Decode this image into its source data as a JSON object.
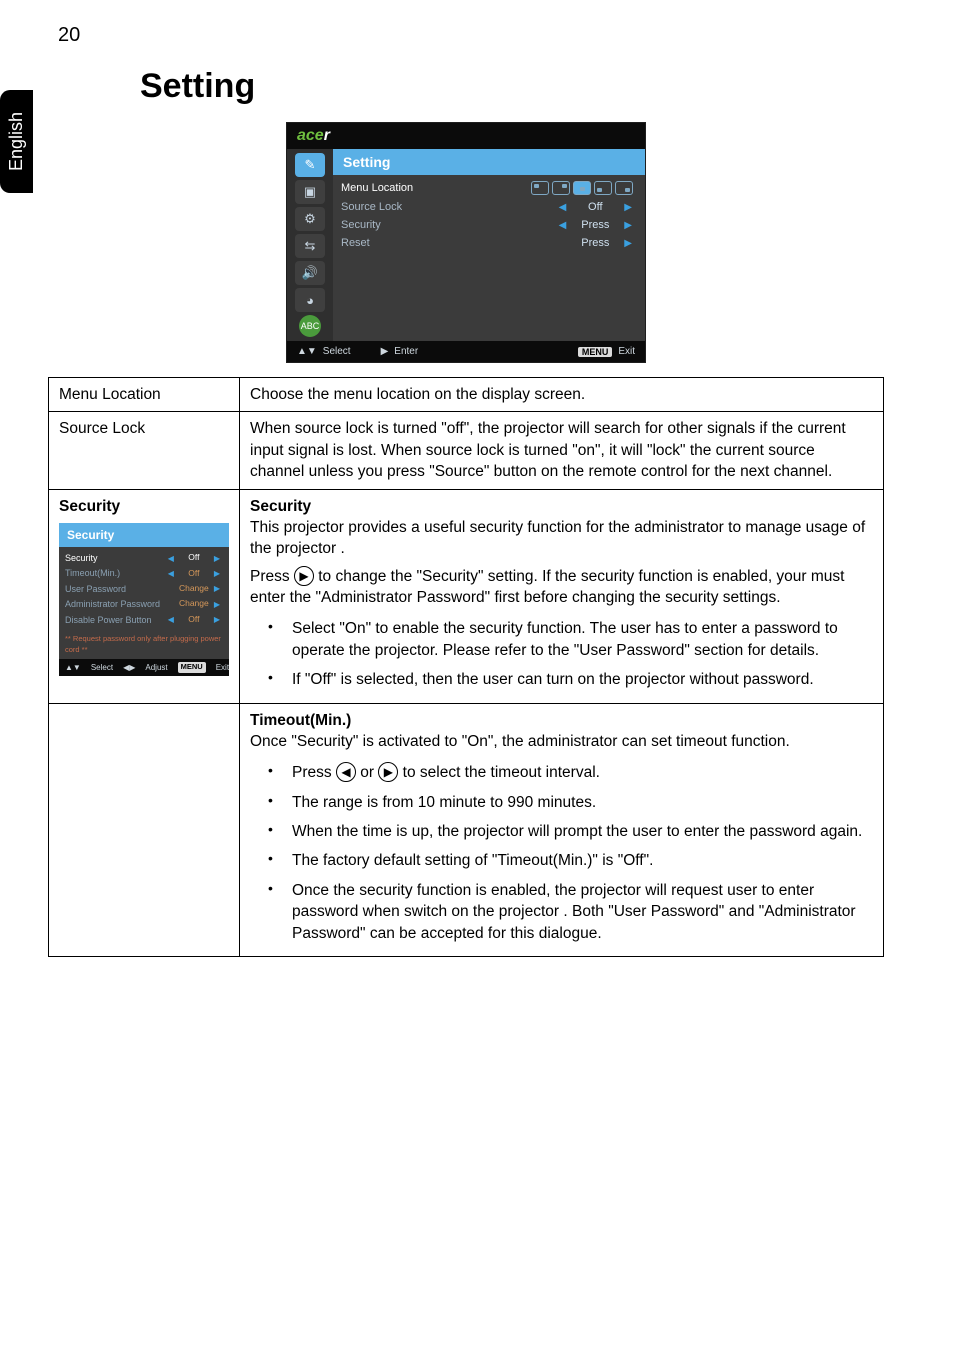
{
  "page_number": "20",
  "side_tab": "English",
  "heading": "Setting",
  "osd": {
    "logo_prefix": "ace",
    "logo_suffix": "r",
    "title": "Setting",
    "rows": [
      {
        "label": "Menu Location"
      },
      {
        "label": "Source Lock",
        "value": "Off"
      },
      {
        "label": "Security",
        "value": "Press"
      },
      {
        "label": "Reset",
        "value": "Press"
      }
    ],
    "icons": {
      "lang": "ABC"
    },
    "footer": {
      "select": "Select",
      "enter": "Enter",
      "menu_key": "MENU",
      "exit": "Exit"
    }
  },
  "sec_osd": {
    "title": "Security",
    "rows": [
      {
        "label": "Security",
        "value": "Off",
        "hi": true
      },
      {
        "label": "Timeout(Min.)",
        "value": "Off"
      },
      {
        "label": "User Password",
        "value": "Change"
      },
      {
        "label": "Administrator Password",
        "value": "Change"
      },
      {
        "label": "Disable Power Button",
        "value": "Off"
      }
    ],
    "note": "** Request password only after plugging power cord **",
    "footer": {
      "select": "Select",
      "adjust": "Adjust",
      "menu_key": "MENU",
      "exit": "Exit"
    }
  },
  "table": {
    "menu_location": {
      "label": "Menu Location",
      "desc": "Choose the menu location on the display screen."
    },
    "source_lock": {
      "label": "Source Lock",
      "desc": "When source lock is turned \"off\", the projector will search for other signals if the current input signal is lost. When source lock is turned \"on\", it will \"lock\" the current source channel unless you press \"Source\" button on the remote control for the next channel."
    },
    "security": {
      "label": "Security",
      "h1": "Security",
      "p1": "This projector provides a useful security function for the administrator to manage usage of the projector .",
      "p2a": "Press ",
      "p2b": " to change the \"Security\" setting. If the security function is enabled, your must enter the \"Administrator Password\" first before changing the security settings.",
      "b1": "Select \"On\" to enable the security function. The user has to enter a password to operate the projector. Please refer to the \"User Password\" section for details.",
      "b2": "If \"Off\" is selected, then the user can turn on the projector without password.",
      "h2": "Timeout(Min.)",
      "p3": "Once \"Security\" is activated to \"On\", the administrator can set timeout function.",
      "tb1a": "Press ",
      "tb1b": " or ",
      "tb1c": " to select the timeout interval.",
      "tb2": "The range is from 10 minute to 990 minutes.",
      "tb3": "When the time is up, the projector will prompt the user to enter the password again.",
      "tb4": "The factory default setting of \"Timeout(Min.)\" is \"Off\".",
      "tb5": "Once the security function is enabled, the projector will request user to enter password when switch on the projector . Both \"User Password\" and \"Administrator Password\" can be accepted for this dialogue."
    }
  }
}
